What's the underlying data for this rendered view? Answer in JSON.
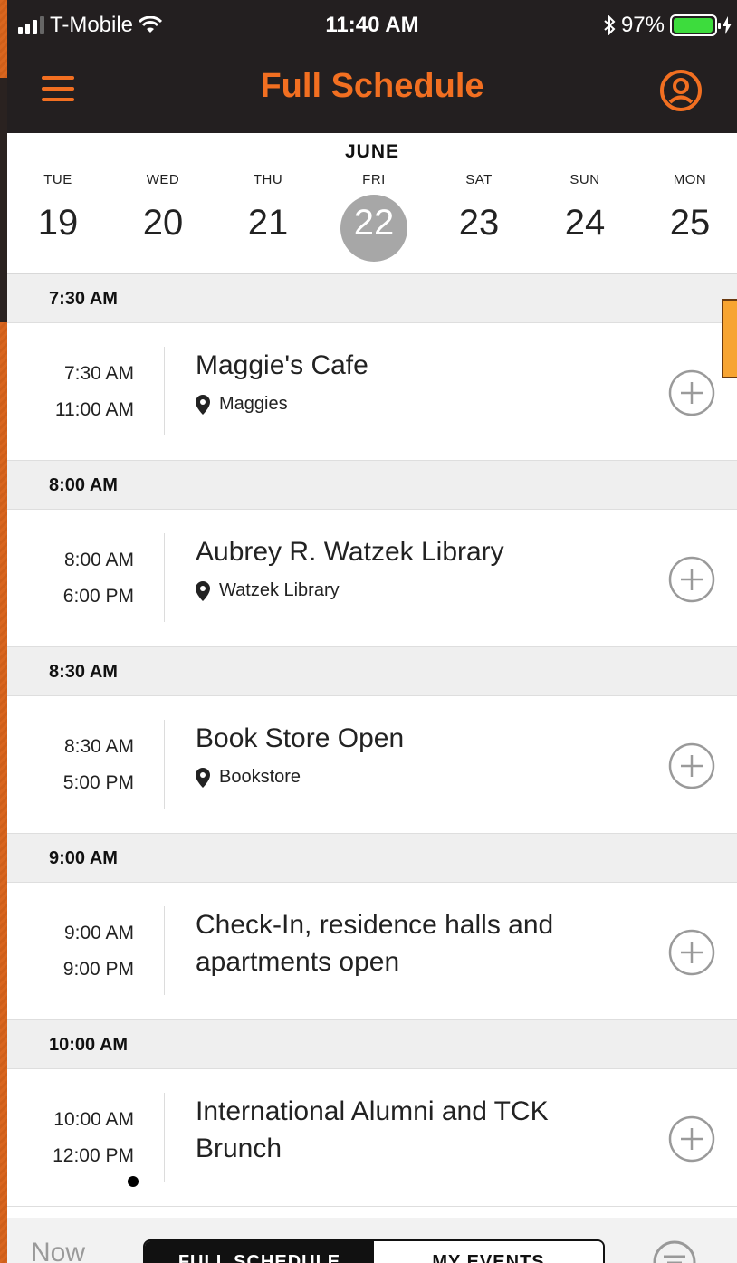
{
  "status_bar": {
    "carrier": "T-Mobile",
    "time": "11:40 AM",
    "battery_percent": "97%",
    "battery_level": 0.97
  },
  "nav": {
    "title": "Full Schedule"
  },
  "calendar": {
    "month": "JUNE",
    "days": [
      {
        "dow": "TUE",
        "num": "19"
      },
      {
        "dow": "WED",
        "num": "20"
      },
      {
        "dow": "THU",
        "num": "21"
      },
      {
        "dow": "FRI",
        "num": "22",
        "selected": true
      },
      {
        "dow": "SAT",
        "num": "23"
      },
      {
        "dow": "SUN",
        "num": "24"
      },
      {
        "dow": "MON",
        "num": "25"
      }
    ]
  },
  "schedule": [
    {
      "section": "7:30 AM",
      "start": "7:30 AM",
      "end": "11:00 AM",
      "title": "Maggie's Cafe",
      "location": "Maggies"
    },
    {
      "section": "8:00 AM",
      "start": "8:00 AM",
      "end": "6:00 PM",
      "title": "Aubrey R. Watzek Library",
      "location": "Watzek Library"
    },
    {
      "section": "8:30 AM",
      "start": "8:30 AM",
      "end": "5:00 PM",
      "title": "Book Store Open",
      "location": "Bookstore"
    },
    {
      "section": "9:00 AM",
      "start": "9:00 AM",
      "end": "9:00 PM",
      "title": "Check-In, residence halls and apartments open",
      "location": ""
    },
    {
      "section": "10:00 AM",
      "start": "10:00 AM",
      "end": "12:00 PM",
      "title": "International Alumni and TCK Brunch",
      "location": "",
      "dot": true
    }
  ],
  "bottom_bar": {
    "now_label": "Now",
    "tab_full": "FULL SCHEDULE",
    "tab_mine": "MY EVENTS"
  },
  "colors": {
    "accent": "#f26f21",
    "topbar": "#231f20",
    "selected_day": "#a7a7a7"
  }
}
